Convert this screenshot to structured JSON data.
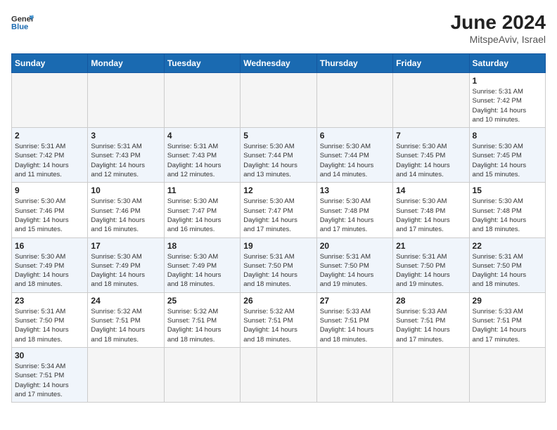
{
  "header": {
    "logo_general": "General",
    "logo_blue": "Blue",
    "month_year": "June 2024",
    "location": "MitspeAviv, Israel"
  },
  "weekdays": [
    "Sunday",
    "Monday",
    "Tuesday",
    "Wednesday",
    "Thursday",
    "Friday",
    "Saturday"
  ],
  "weeks": [
    [
      {
        "day": "",
        "info": ""
      },
      {
        "day": "",
        "info": ""
      },
      {
        "day": "",
        "info": ""
      },
      {
        "day": "",
        "info": ""
      },
      {
        "day": "",
        "info": ""
      },
      {
        "day": "",
        "info": ""
      },
      {
        "day": "1",
        "info": "Sunrise: 5:31 AM\nSunset: 7:42 PM\nDaylight: 14 hours\nand 10 minutes."
      }
    ],
    [
      {
        "day": "2",
        "info": "Sunrise: 5:31 AM\nSunset: 7:42 PM\nDaylight: 14 hours\nand 11 minutes."
      },
      {
        "day": "3",
        "info": "Sunrise: 5:31 AM\nSunset: 7:43 PM\nDaylight: 14 hours\nand 12 minutes."
      },
      {
        "day": "4",
        "info": "Sunrise: 5:31 AM\nSunset: 7:43 PM\nDaylight: 14 hours\nand 12 minutes."
      },
      {
        "day": "5",
        "info": "Sunrise: 5:30 AM\nSunset: 7:44 PM\nDaylight: 14 hours\nand 13 minutes."
      },
      {
        "day": "6",
        "info": "Sunrise: 5:30 AM\nSunset: 7:44 PM\nDaylight: 14 hours\nand 14 minutes."
      },
      {
        "day": "7",
        "info": "Sunrise: 5:30 AM\nSunset: 7:45 PM\nDaylight: 14 hours\nand 14 minutes."
      },
      {
        "day": "8",
        "info": "Sunrise: 5:30 AM\nSunset: 7:45 PM\nDaylight: 14 hours\nand 15 minutes."
      }
    ],
    [
      {
        "day": "9",
        "info": "Sunrise: 5:30 AM\nSunset: 7:46 PM\nDaylight: 14 hours\nand 15 minutes."
      },
      {
        "day": "10",
        "info": "Sunrise: 5:30 AM\nSunset: 7:46 PM\nDaylight: 14 hours\nand 16 minutes."
      },
      {
        "day": "11",
        "info": "Sunrise: 5:30 AM\nSunset: 7:47 PM\nDaylight: 14 hours\nand 16 minutes."
      },
      {
        "day": "12",
        "info": "Sunrise: 5:30 AM\nSunset: 7:47 PM\nDaylight: 14 hours\nand 17 minutes."
      },
      {
        "day": "13",
        "info": "Sunrise: 5:30 AM\nSunset: 7:48 PM\nDaylight: 14 hours\nand 17 minutes."
      },
      {
        "day": "14",
        "info": "Sunrise: 5:30 AM\nSunset: 7:48 PM\nDaylight: 14 hours\nand 17 minutes."
      },
      {
        "day": "15",
        "info": "Sunrise: 5:30 AM\nSunset: 7:48 PM\nDaylight: 14 hours\nand 18 minutes."
      }
    ],
    [
      {
        "day": "16",
        "info": "Sunrise: 5:30 AM\nSunset: 7:49 PM\nDaylight: 14 hours\nand 18 minutes."
      },
      {
        "day": "17",
        "info": "Sunrise: 5:30 AM\nSunset: 7:49 PM\nDaylight: 14 hours\nand 18 minutes."
      },
      {
        "day": "18",
        "info": "Sunrise: 5:30 AM\nSunset: 7:49 PM\nDaylight: 14 hours\nand 18 minutes."
      },
      {
        "day": "19",
        "info": "Sunrise: 5:31 AM\nSunset: 7:50 PM\nDaylight: 14 hours\nand 18 minutes."
      },
      {
        "day": "20",
        "info": "Sunrise: 5:31 AM\nSunset: 7:50 PM\nDaylight: 14 hours\nand 19 minutes."
      },
      {
        "day": "21",
        "info": "Sunrise: 5:31 AM\nSunset: 7:50 PM\nDaylight: 14 hours\nand 19 minutes."
      },
      {
        "day": "22",
        "info": "Sunrise: 5:31 AM\nSunset: 7:50 PM\nDaylight: 14 hours\nand 18 minutes."
      }
    ],
    [
      {
        "day": "23",
        "info": "Sunrise: 5:31 AM\nSunset: 7:50 PM\nDaylight: 14 hours\nand 18 minutes."
      },
      {
        "day": "24",
        "info": "Sunrise: 5:32 AM\nSunset: 7:51 PM\nDaylight: 14 hours\nand 18 minutes."
      },
      {
        "day": "25",
        "info": "Sunrise: 5:32 AM\nSunset: 7:51 PM\nDaylight: 14 hours\nand 18 minutes."
      },
      {
        "day": "26",
        "info": "Sunrise: 5:32 AM\nSunset: 7:51 PM\nDaylight: 14 hours\nand 18 minutes."
      },
      {
        "day": "27",
        "info": "Sunrise: 5:33 AM\nSunset: 7:51 PM\nDaylight: 14 hours\nand 18 minutes."
      },
      {
        "day": "28",
        "info": "Sunrise: 5:33 AM\nSunset: 7:51 PM\nDaylight: 14 hours\nand 17 minutes."
      },
      {
        "day": "29",
        "info": "Sunrise: 5:33 AM\nSunset: 7:51 PM\nDaylight: 14 hours\nand 17 minutes."
      }
    ],
    [
      {
        "day": "30",
        "info": "Sunrise: 5:34 AM\nSunset: 7:51 PM\nDaylight: 14 hours\nand 17 minutes."
      },
      {
        "day": "",
        "info": ""
      },
      {
        "day": "",
        "info": ""
      },
      {
        "day": "",
        "info": ""
      },
      {
        "day": "",
        "info": ""
      },
      {
        "day": "",
        "info": ""
      },
      {
        "day": "",
        "info": ""
      }
    ]
  ]
}
